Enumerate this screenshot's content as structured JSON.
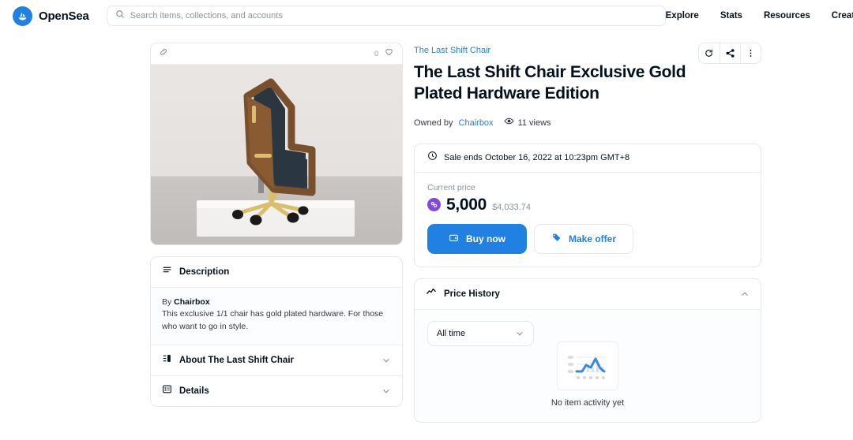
{
  "header": {
    "brand": "OpenSea",
    "logo_icon": "opensea-sailboat-logo",
    "search": {
      "placeholder": "Search items, collections, and accounts",
      "value": "",
      "icon": "search-icon"
    },
    "nav": [
      {
        "label": "Explore"
      },
      {
        "label": "Stats"
      },
      {
        "label": "Resources"
      },
      {
        "label": "Create"
      }
    ]
  },
  "item_card": {
    "chain_icon": "chain-link-icon",
    "favorite_count": "0",
    "favorite_icon": "heart-icon",
    "artwork_alt": "Coffin shaped office chair with gold plated hardware"
  },
  "panels": {
    "description": {
      "icon": "list-lines-icon",
      "title": "Description",
      "expanded": true,
      "chevron": "chevron-up-icon",
      "by_prefix": "By ",
      "by_author": "Chairbox",
      "body": "This exclusive 1/1 chair has gold plated hardware. For those who want to go in style."
    },
    "about": {
      "icon": "collection-bars-icon",
      "title": "About The Last Shift Chair",
      "expanded": false,
      "chevron": "chevron-down-icon"
    },
    "details": {
      "icon": "details-grid-icon",
      "title": "Details",
      "expanded": false,
      "chevron": "chevron-down-icon"
    }
  },
  "detail": {
    "collection": "The Last Shift Chair",
    "title": "The Last Shift Chair Exclusive Gold Plated Hardware Edition",
    "owned_by_prefix": "Owned by",
    "owner": "Chairbox",
    "views_icon": "eye-icon",
    "views": "11 views",
    "actions": [
      {
        "name": "refresh-metadata-button",
        "icon": "refresh-icon"
      },
      {
        "name": "share-button",
        "icon": "share-icon"
      },
      {
        "name": "more-options-button",
        "icon": "more-vertical-icon"
      }
    ]
  },
  "price_panel": {
    "clock_icon": "clock-icon",
    "sale_ends": "Sale ends October 16, 2022 at 10:23pm GMT+8",
    "current_price_label": "Current price",
    "token_icon": "polygon-token-icon",
    "price_amount": "5,000",
    "price_usd": "$4,033.74",
    "buy_button": {
      "label": "Buy now",
      "icon": "wallet-icon"
    },
    "offer_button": {
      "label": "Make offer",
      "icon": "tag-icon"
    }
  },
  "price_history": {
    "icon": "chart-line-icon",
    "title": "Price History",
    "expanded": true,
    "chevron": "chevron-up-icon",
    "range_selected": "All time",
    "range_chevron": "chevron-down-icon",
    "empty_icon": "empty-chart-icon",
    "empty_text": "No item activity yet"
  },
  "colors": {
    "accent": "#2081e2",
    "text": "#04111d",
    "muted": "#8a939b",
    "border": "#e5e8eb",
    "token_purple": "#8247e5"
  }
}
